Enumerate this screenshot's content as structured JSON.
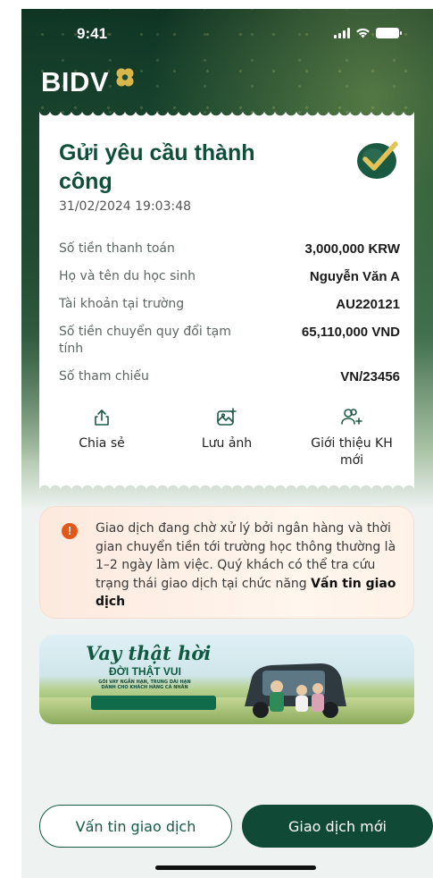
{
  "status_bar": {
    "time": "9:41"
  },
  "brand": {
    "name": "BIDV"
  },
  "receipt": {
    "title": "Gửi yêu cầu thành công",
    "datetime": "31/02/2024 19:03:48",
    "rows": [
      {
        "label": "Số tiền thanh toán",
        "value": "3,000,000 KRW"
      },
      {
        "label": "Họ và tên du học sinh",
        "value": "Nguyễn Văn A"
      },
      {
        "label": "Tài khoản tại trường",
        "value": "AU220121"
      },
      {
        "label": "Số tiền chuyển quy đổi tạm tính",
        "value": "65,110,000 VND"
      },
      {
        "label": "Số tham chiếu",
        "value": "VN/23456"
      }
    ],
    "actions": [
      {
        "label": "Chia sẻ",
        "icon": "share-icon"
      },
      {
        "label": "Lưu ảnh",
        "icon": "save-image-icon"
      },
      {
        "label": "Giới thiệu KH mới",
        "icon": "add-user-icon"
      }
    ]
  },
  "notice": {
    "text": "Giao dịch đang chờ xử lý bởi ngân hàng và thời gian chuyển tiền tới trường học thông thường là 1–2 ngày làm việc. Quý khách có thể tra cứu trạng thái giao dịch tại chức năng ",
    "link": "Vấn tin giao dịch"
  },
  "banner": {
    "slogan_line1": "Vay thật hời",
    "slogan_line2": "ĐỜI THẬT VUI",
    "subtitle": "GÓI VAY NGẮN HẠN, TRUNG DÀI HẠN DÀNH CHO KHÁCH HÀNG CÁ NHÂN"
  },
  "buttons": {
    "inquiry": "Vấn tin giao dịch",
    "new_transaction": "Giao dịch mới"
  },
  "colors": {
    "brand_green": "#104a37",
    "accent_gold": "#d9b74a",
    "warning": "#e2581b"
  }
}
